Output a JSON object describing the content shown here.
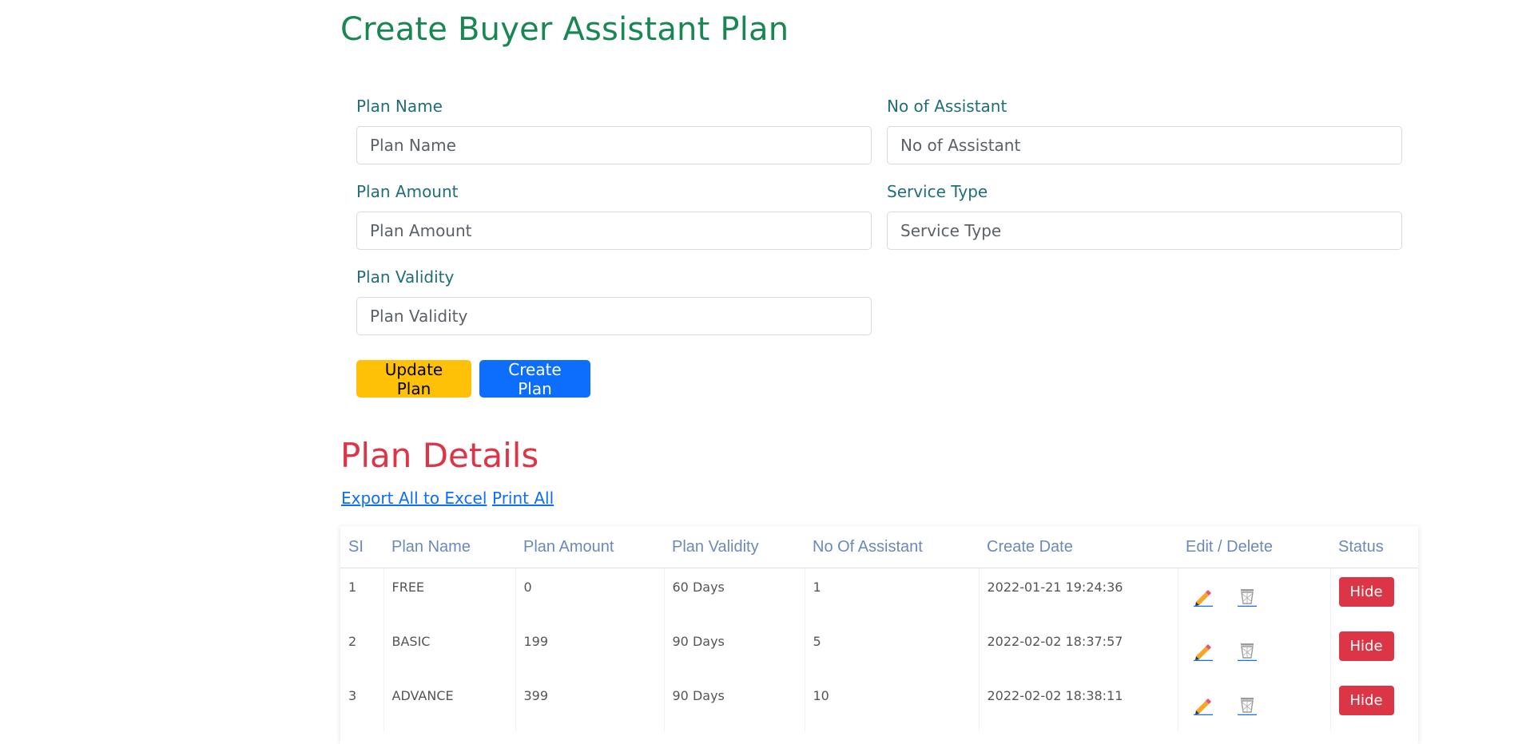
{
  "page": {
    "title": "Create Buyer Assistant Plan"
  },
  "form": {
    "plan_name": {
      "label": "Plan Name",
      "placeholder": "Plan Name",
      "value": ""
    },
    "no_of_assistant": {
      "label": "No of Assistant",
      "placeholder": "No of Assistant",
      "value": ""
    },
    "plan_amount": {
      "label": "Plan Amount",
      "placeholder": "Plan Amount",
      "value": ""
    },
    "service_type": {
      "label": "Service Type",
      "placeholder": "Service Type",
      "value": ""
    },
    "plan_validity": {
      "label": "Plan Validity",
      "placeholder": "Plan Validity",
      "value": ""
    },
    "update_label": "Update Plan",
    "create_label": "Create Plan"
  },
  "details": {
    "title": "Plan Details",
    "export_label": "Export All to Excel",
    "print_label": "Print All",
    "columns": [
      "SI",
      "Plan Name",
      "Plan Amount",
      "Plan Validity",
      "No Of Assistant",
      "Create Date",
      "Edit / Delete",
      "Status"
    ],
    "rows": [
      {
        "si": "1",
        "name": "FREE",
        "amount": "0",
        "validity": "60 Days",
        "assistants": "1",
        "date": "2022-01-21 19:24:36",
        "status": "Hide"
      },
      {
        "si": "2",
        "name": "BASIC",
        "amount": "199",
        "validity": "90 Days",
        "assistants": "5",
        "date": "2022-02-02 18:37:57",
        "status": "Hide"
      },
      {
        "si": "3",
        "name": "ADVANCE",
        "amount": "399",
        "validity": "90 Days",
        "assistants": "10",
        "date": "2022-02-02 18:38:11",
        "status": "Hide"
      }
    ],
    "icons": {
      "edit": "pencil-icon",
      "delete": "trash-icon"
    },
    "colors": {
      "title": "#198754",
      "section": "#dc3545",
      "update": "#ffc107",
      "create": "#0d6efd",
      "hide": "#dc3545"
    }
  }
}
